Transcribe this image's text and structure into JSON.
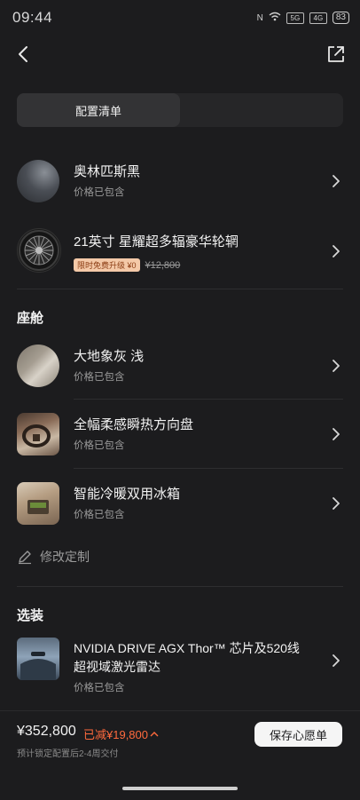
{
  "status_bar": {
    "time": "09:44",
    "network_1": "5G",
    "network_2": "4G",
    "battery": "83"
  },
  "tabs": {
    "active_label": "配置清单"
  },
  "exterior": [
    {
      "title": "奥林匹斯黑",
      "subtitle": "价格已包含",
      "icon": "paint-swatch-black"
    },
    {
      "title": "21英寸 星耀超多辐豪华轮辋",
      "badge": "限时免费升级 ¥0",
      "original_price": "¥12,800",
      "icon": "wheel"
    }
  ],
  "cabin": {
    "section_title": "座舱",
    "items": [
      {
        "title": "大地象灰 浅",
        "subtitle": "价格已包含",
        "icon": "interior-color-swatch"
      },
      {
        "title": "全幅柔感瞬热方向盘",
        "subtitle": "价格已包含",
        "icon": "steering-wheel-photo"
      },
      {
        "title": "智能冷暖双用冰箱",
        "subtitle": "价格已包含",
        "icon": "fridge-photo"
      }
    ]
  },
  "edit_link": {
    "label": "修改定制",
    "icon": "pencil-icon"
  },
  "options": {
    "section_title": "选装",
    "items": [
      {
        "title_line1": "NVIDIA DRIVE AGX Thor™ 芯片及520线",
        "title_line2": "超视域激光雷达",
        "subtitle": "价格已包含",
        "icon": "lidar-photo"
      }
    ]
  },
  "bottom_bar": {
    "price": "¥352,800",
    "discount": "已减¥19,800",
    "delivery": "预计锁定配置后2-4周交付",
    "wishlist_label": "保存心愿单"
  },
  "colors": {
    "background": "#1c1c1e",
    "accent_orange": "#ff6a3d",
    "badge_bg": "#f4c9a8"
  }
}
